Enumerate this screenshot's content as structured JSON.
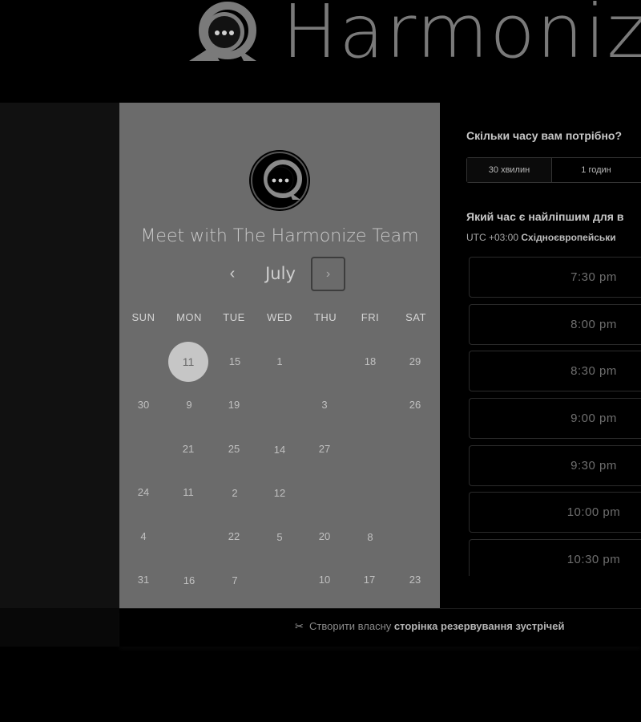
{
  "header": {
    "logo_text": "Harmoniz"
  },
  "calendar": {
    "title": "Meet with The Harmonize Team",
    "month": "July",
    "prev_symbol": "‹",
    "next_symbol": "›",
    "weekdays": [
      "SUN",
      "MON",
      "TUE",
      "WED",
      "THU",
      "FRI",
      "SAT"
    ],
    "weeks": [
      [
        "",
        "11",
        "15",
        "1",
        "",
        "18",
        "29"
      ],
      [
        "30",
        "9",
        "19",
        "",
        "3",
        "",
        "26"
      ],
      [
        "",
        "21",
        "25",
        "14",
        "27",
        "",
        ""
      ],
      [
        "24",
        "11",
        "2",
        "12",
        "",
        "",
        ""
      ],
      [
        "4",
        "",
        "22",
        "5",
        "20",
        "8",
        ""
      ],
      [
        "31",
        "16",
        "7",
        "",
        "10",
        "17",
        "23"
      ]
    ],
    "selected_day": "11"
  },
  "booking": {
    "duration_question": "Скільки часу вам потрібно?",
    "duration_options": [
      "30 хвилин",
      "1 годин"
    ],
    "time_question": "Який час є найліпшим для в",
    "timezone_offset": "UTC +03:00",
    "timezone_name": "Східноєвропейськи",
    "time_slots": [
      "7:30 pm",
      "8:00 pm",
      "8:30 pm",
      "9:00 pm",
      "9:30 pm",
      "10:00 pm",
      "10:30 pm"
    ]
  },
  "footer": {
    "icon": "scissors-icon",
    "prefix": "Створити власну",
    "link_bold": "сторінка резервування зустрічей"
  }
}
